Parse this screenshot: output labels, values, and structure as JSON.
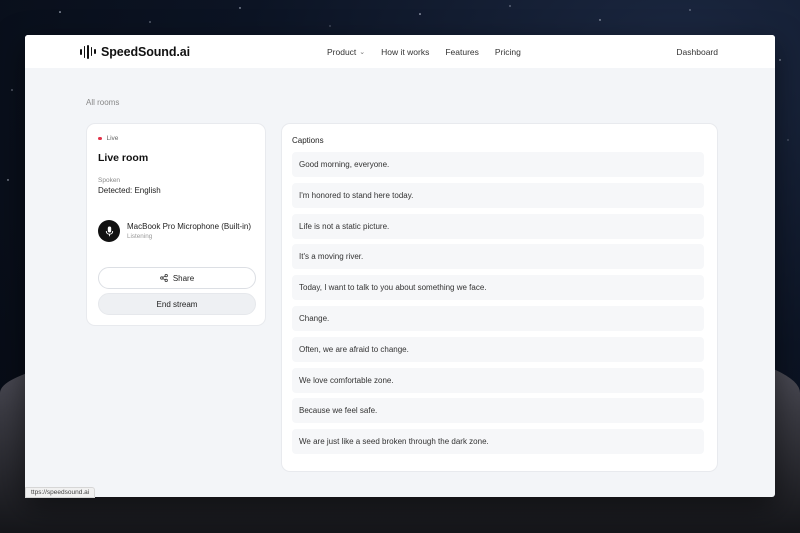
{
  "brand": {
    "name": "SpeedSound.ai"
  },
  "nav": {
    "items": [
      {
        "label": "Product",
        "has_dropdown": true
      },
      {
        "label": "How it works"
      },
      {
        "label": "Features"
      },
      {
        "label": "Pricing"
      }
    ],
    "dashboard": "Dashboard"
  },
  "breadcrumb": "All rooms",
  "room": {
    "status": "Live",
    "title": "Live room",
    "spoken_label": "Spoken",
    "detected": "Detected: English",
    "mic_name": "MacBook Pro Microphone (Built-in)",
    "mic_status": "Listening",
    "share_label": "Share",
    "end_label": "End stream"
  },
  "captions": {
    "title": "Captions",
    "items": [
      "Good morning, everyone.",
      "I'm honored to stand here today.",
      "Life is not a static picture.",
      "It's a moving river.",
      "Today, I want to talk to you about something we face.",
      "Change.",
      "Often, we are afraid to change.",
      "We love comfortable zone.",
      "Because we feel safe.",
      "We are just like a seed broken through the dark zone."
    ]
  },
  "status_url": "ttps://speedsound.ai",
  "colors": {
    "live_dot": "#e2334a",
    "accent": "#111111"
  }
}
